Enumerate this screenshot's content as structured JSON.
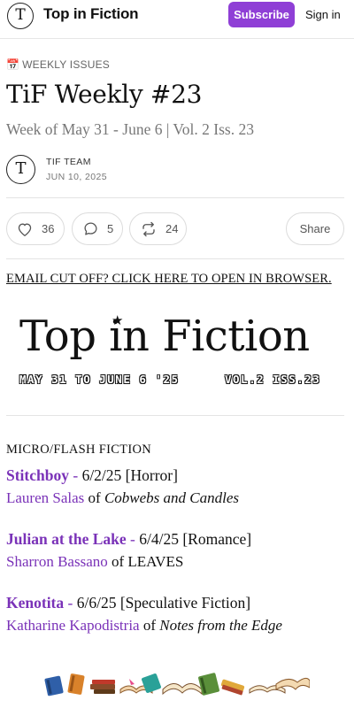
{
  "topbar": {
    "logo_letter": "T",
    "publication": "Top in Fiction",
    "subscribe": "Subscribe",
    "signin": "Sign in"
  },
  "post": {
    "section_icon": "calendar-icon",
    "section": "WEEKLY ISSUES",
    "title": "TiF Weekly #23",
    "subtitle": "Week of May 31 - June 6 | Vol. 2 Iss. 23",
    "author": "TIF TEAM",
    "date": "JUN 10, 2025"
  },
  "engagement": {
    "likes": "36",
    "comments": "5",
    "restacks": "24",
    "share": "Share"
  },
  "email_link": "EMAIL CUT OFF? CLICK HERE TO OPEN IN BROWSER.",
  "banner": {
    "title": "Top in Fiction",
    "dates": "MAY 31 TO JUNE 6 '25",
    "volume": "VOL.2 ISS.23"
  },
  "fiction": {
    "category": "MICRO/FLASH FICTION",
    "entries": [
      {
        "title": "Stitchboy",
        "sep": " - ",
        "date": "6/2/25",
        "genre": "[Horror]",
        "author": "Lauren Salas",
        "of": " of ",
        "publication": "Cobwebs and Candles",
        "pub_italic": true
      },
      {
        "title": "Julian at the Lake",
        "sep": " - ",
        "date": "6/4/25",
        "genre": "[Romance]",
        "author": "Sharron Bassano",
        "of": " of ",
        "publication": "LEAVES",
        "pub_italic": false
      },
      {
        "title": "Kenotita",
        "sep": " - ",
        "date": "6/6/25",
        "genre": "[Speculative Fiction]",
        "author": "Katharine Kapodistria",
        "of": " of ",
        "publication": "Notes from the Edge",
        "pub_italic": true
      }
    ]
  },
  "colors": {
    "accent": "#8f3fd6",
    "link": "#7a32b8"
  },
  "decor": {
    "books_icon": "books-row-icon"
  }
}
